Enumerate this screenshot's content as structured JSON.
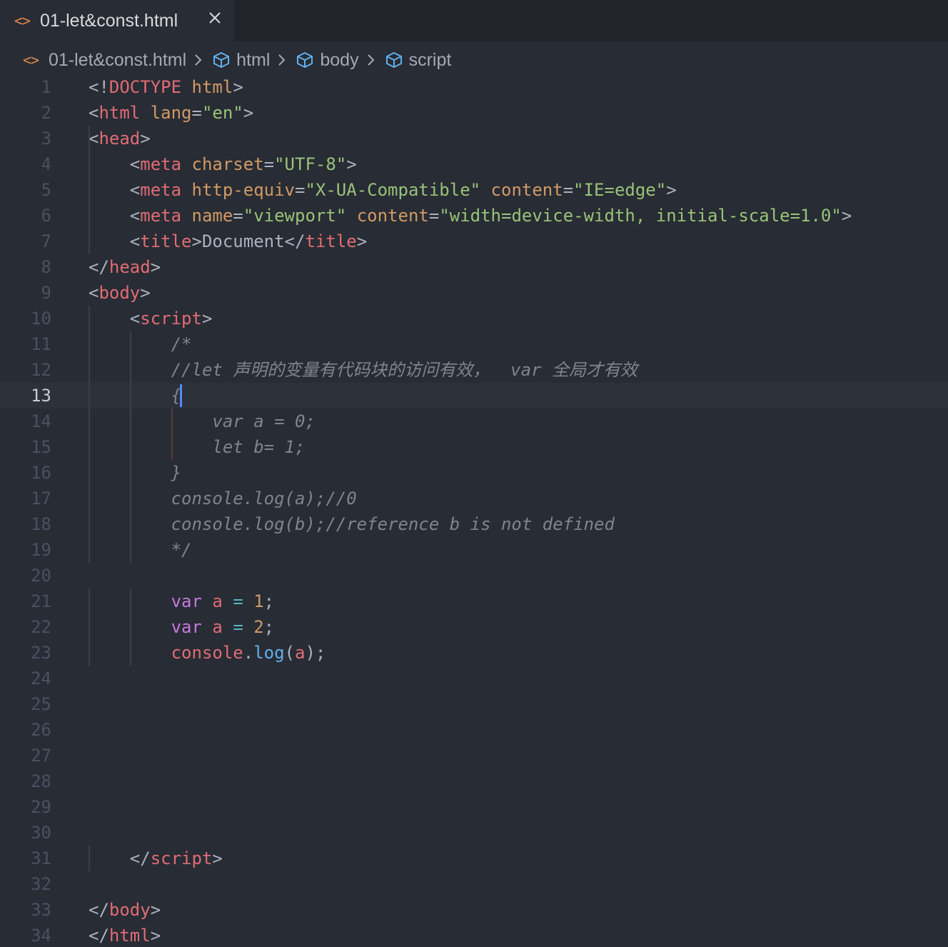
{
  "tab": {
    "icon": "html-file-icon",
    "label": "01-let&const.html"
  },
  "breadcrumb": {
    "file": "01-let&const.html",
    "items": [
      "html",
      "body",
      "script"
    ]
  },
  "editor": {
    "current_line": 13,
    "line_numbers": [
      "1",
      "2",
      "3",
      "4",
      "5",
      "6",
      "7",
      "8",
      "9",
      "10",
      "11",
      "12",
      "13",
      "14",
      "15",
      "16",
      "17",
      "18",
      "19",
      "20",
      "21",
      "22",
      "23",
      "24",
      "25",
      "26",
      "27",
      "28",
      "29",
      "30",
      "31",
      "32",
      "33",
      "34"
    ],
    "lines": [
      [
        [
          "punc",
          "<!"
        ],
        [
          "tag",
          "DOCTYPE"
        ],
        [
          "punc",
          " "
        ],
        [
          "attr",
          "html"
        ],
        [
          "punc",
          ">"
        ]
      ],
      [
        [
          "punc",
          "<"
        ],
        [
          "tag",
          "html"
        ],
        [
          "punc",
          " "
        ],
        [
          "attr",
          "lang"
        ],
        [
          "punc",
          "="
        ],
        [
          "str",
          "\"en\""
        ],
        [
          "punc",
          ">"
        ]
      ],
      [
        [
          "punc",
          "<"
        ],
        [
          "tag",
          "head"
        ],
        [
          "punc",
          ">"
        ]
      ],
      [
        [
          "punc",
          "    <"
        ],
        [
          "tag",
          "meta"
        ],
        [
          "punc",
          " "
        ],
        [
          "attr",
          "charset"
        ],
        [
          "punc",
          "="
        ],
        [
          "str",
          "\"UTF-8\""
        ],
        [
          "punc",
          ">"
        ]
      ],
      [
        [
          "punc",
          "    <"
        ],
        [
          "tag",
          "meta"
        ],
        [
          "punc",
          " "
        ],
        [
          "attr",
          "http-equiv"
        ],
        [
          "punc",
          "="
        ],
        [
          "str",
          "\"X-UA-Compatible\""
        ],
        [
          "punc",
          " "
        ],
        [
          "attr",
          "content"
        ],
        [
          "punc",
          "="
        ],
        [
          "str",
          "\"IE=edge\""
        ],
        [
          "punc",
          ">"
        ]
      ],
      [
        [
          "punc",
          "    <"
        ],
        [
          "tag",
          "meta"
        ],
        [
          "punc",
          " "
        ],
        [
          "attr",
          "name"
        ],
        [
          "punc",
          "="
        ],
        [
          "str",
          "\"viewport\""
        ],
        [
          "punc",
          " "
        ],
        [
          "attr",
          "content"
        ],
        [
          "punc",
          "="
        ],
        [
          "str",
          "\"width=device-width, initial-scale=1.0\""
        ],
        [
          "punc",
          ">"
        ]
      ],
      [
        [
          "punc",
          "    <"
        ],
        [
          "tag",
          "title"
        ],
        [
          "punc",
          ">"
        ],
        [
          "text",
          "Document"
        ],
        [
          "punc",
          "</"
        ],
        [
          "tag",
          "title"
        ],
        [
          "punc",
          ">"
        ]
      ],
      [
        [
          "punc",
          "</"
        ],
        [
          "tag",
          "head"
        ],
        [
          "punc",
          ">"
        ]
      ],
      [
        [
          "punc",
          "<"
        ],
        [
          "tag",
          "body"
        ],
        [
          "punc",
          ">"
        ]
      ],
      [
        [
          "punc",
          "    <"
        ],
        [
          "tag",
          "script"
        ],
        [
          "punc",
          ">"
        ]
      ],
      [
        [
          "com",
          "        /*"
        ]
      ],
      [
        [
          "com",
          "        //let 声明的变量有代码块的访问有效，  var 全局才有效"
        ]
      ],
      [
        [
          "com",
          "        {"
        ]
      ],
      [
        [
          "com",
          "            var a = 0;"
        ]
      ],
      [
        [
          "com",
          "            let b= 1;"
        ]
      ],
      [
        [
          "com",
          "        }"
        ]
      ],
      [
        [
          "com",
          "        console.log(a);//0"
        ]
      ],
      [
        [
          "com",
          "        console.log(b);//reference b is not defined"
        ]
      ],
      [
        [
          "com",
          "        */"
        ]
      ],
      [],
      [
        [
          "punc",
          "        "
        ],
        [
          "kw",
          "var"
        ],
        [
          "punc",
          " "
        ],
        [
          "var",
          "a"
        ],
        [
          "punc",
          " "
        ],
        [
          "op",
          "="
        ],
        [
          "punc",
          " "
        ],
        [
          "num",
          "1"
        ],
        [
          "punc",
          ";"
        ]
      ],
      [
        [
          "punc",
          "        "
        ],
        [
          "kw",
          "var"
        ],
        [
          "punc",
          " "
        ],
        [
          "var",
          "a"
        ],
        [
          "punc",
          " "
        ],
        [
          "op",
          "="
        ],
        [
          "punc",
          " "
        ],
        [
          "num",
          "2"
        ],
        [
          "punc",
          ";"
        ]
      ],
      [
        [
          "punc",
          "        "
        ],
        [
          "obj",
          "console"
        ],
        [
          "punc",
          "."
        ],
        [
          "fn",
          "log"
        ],
        [
          "punc",
          "("
        ],
        [
          "var",
          "a"
        ],
        [
          "punc",
          ");"
        ]
      ],
      [],
      [],
      [],
      [],
      [],
      [],
      [],
      [
        [
          "punc",
          "    </"
        ],
        [
          "tag",
          "script"
        ],
        [
          "punc",
          ">"
        ]
      ],
      [],
      [
        [
          "punc",
          "</"
        ],
        [
          "tag",
          "body"
        ],
        [
          "punc",
          ">"
        ]
      ],
      [
        [
          "punc",
          "</"
        ],
        [
          "tag",
          "html"
        ],
        [
          "punc",
          ">"
        ]
      ]
    ]
  },
  "colors": {
    "background": "#282c34",
    "tab_bar": "#21252b",
    "current_line": "#2c313a",
    "cursor": "#528bff",
    "tag": "#e06c75",
    "attribute": "#d19a66",
    "string": "#98c379",
    "keyword": "#c678dd",
    "function": "#61afef",
    "comment": "#7f848e",
    "file_icon": "#e5894a",
    "breadcrumb_icon": "#61afef"
  }
}
